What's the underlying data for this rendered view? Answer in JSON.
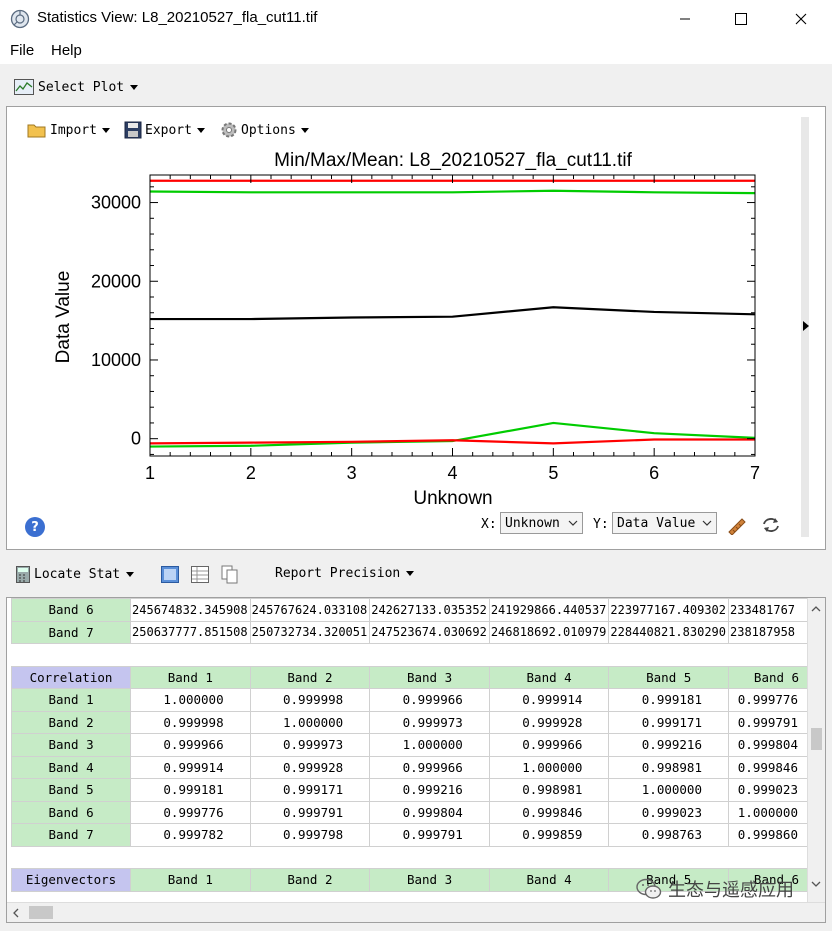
{
  "window": {
    "title": "Statistics View: L8_20210527_fla_cut11.tif",
    "icons": {
      "app": "statistics-app-icon",
      "minimize": "minimize-icon",
      "maximize": "maximize-icon",
      "close": "close-icon"
    }
  },
  "menu": {
    "file": "File",
    "help": "Help"
  },
  "select_plot": {
    "label": "Select Plot"
  },
  "plot_toolbar": {
    "import": "Import",
    "export": "Export",
    "options": "Options"
  },
  "plot_controls": {
    "x_label": "X:",
    "x_value": "Unknown",
    "y_label": "Y:",
    "y_value": "Data Value",
    "help": "?"
  },
  "chart_data": {
    "type": "line",
    "title": "Min/Max/Mean: L8_20210527_fla_cut11.tif",
    "xlabel": "Unknown",
    "ylabel": "Data Value",
    "x": [
      1,
      2,
      3,
      4,
      5,
      6,
      7
    ],
    "xlim": [
      1,
      7
    ],
    "ylim": [
      -2200,
      33500
    ],
    "xticks": [
      "1",
      "2",
      "3",
      "4",
      "5",
      "6",
      "7"
    ],
    "yticks": [
      0,
      10000,
      20000,
      30000
    ],
    "ytick_labels": [
      "0",
      "10000",
      "20000",
      "30000"
    ],
    "grid": false,
    "series": [
      {
        "color": "#ff0000",
        "values": [
          32767,
          32767,
          32767,
          32767,
          32767,
          32767,
          32767
        ]
      },
      {
        "color": "#00cc00",
        "values": [
          31400,
          31300,
          31300,
          31300,
          31500,
          31300,
          31200
        ]
      },
      {
        "color": "#000000",
        "values": [
          15200,
          15200,
          15400,
          15500,
          16700,
          16100,
          15800
        ]
      },
      {
        "color": "#00cc00",
        "values": [
          -1000,
          -900,
          -500,
          -300,
          2000,
          700,
          100
        ]
      },
      {
        "color": "#ff0000",
        "values": [
          -600,
          -500,
          -400,
          -200,
          -600,
          -100,
          -100
        ]
      }
    ]
  },
  "lower_toolbar": {
    "locate_stat": "Locate Stat",
    "report_precision": "Report Precision"
  },
  "table": {
    "top_rows": [
      {
        "label": "Band 6",
        "cells": [
          "245674832.345908",
          "245767624.033108",
          "242627133.035352",
          "241929866.440537",
          "223977167.409302",
          "233481767"
        ]
      },
      {
        "label": "Band 7",
        "cells": [
          "250637777.851508",
          "250732734.320051",
          "247523674.030692",
          "246818692.010979",
          "228440821.830290",
          "238187958"
        ]
      }
    ],
    "correlation": {
      "header": "Correlation",
      "columns": [
        "Band 1",
        "Band 2",
        "Band 3",
        "Band 4",
        "Band 5",
        "Band 6"
      ],
      "rows": [
        {
          "label": "Band 1",
          "cells": [
            "1.000000",
            "0.999998",
            "0.999966",
            "0.999914",
            "0.999181",
            "0.999776"
          ]
        },
        {
          "label": "Band 2",
          "cells": [
            "0.999998",
            "1.000000",
            "0.999973",
            "0.999928",
            "0.999171",
            "0.999791"
          ]
        },
        {
          "label": "Band 3",
          "cells": [
            "0.999966",
            "0.999973",
            "1.000000",
            "0.999966",
            "0.999216",
            "0.999804"
          ]
        },
        {
          "label": "Band 4",
          "cells": [
            "0.999914",
            "0.999928",
            "0.999966",
            "1.000000",
            "0.998981",
            "0.999846"
          ]
        },
        {
          "label": "Band 5",
          "cells": [
            "0.999181",
            "0.999171",
            "0.999216",
            "0.998981",
            "1.000000",
            "0.999023"
          ]
        },
        {
          "label": "Band 6",
          "cells": [
            "0.999776",
            "0.999791",
            "0.999804",
            "0.999846",
            "0.999023",
            "1.000000"
          ]
        },
        {
          "label": "Band 7",
          "cells": [
            "0.999782",
            "0.999798",
            "0.999791",
            "0.999859",
            "0.998763",
            "0.999860"
          ]
        }
      ]
    },
    "eigenvectors": {
      "header": "Eigenvectors",
      "columns": [
        "Band 1",
        "Band 2",
        "Band 3",
        "Band 4",
        "Band 5",
        "Band 6"
      ]
    }
  },
  "watermark": {
    "text": "生态与遥感应用",
    "icon": "wechat-icon"
  }
}
